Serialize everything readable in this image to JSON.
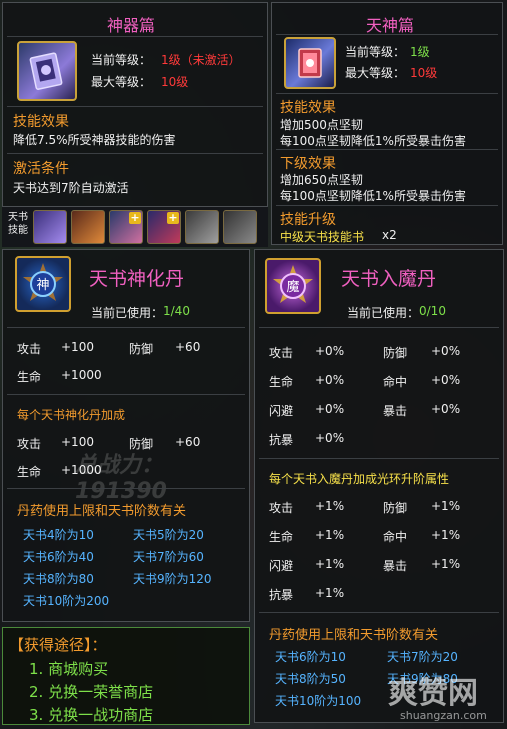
{
  "shenqi": {
    "title": "神器篇",
    "current_level_label": "当前等级：",
    "current_level_value": "1级（未激活）",
    "max_level_label": "最大等级：",
    "max_level_value": "10级",
    "effect_heading": "技能效果",
    "effect_text": "降低7.5%所受神器技能的伤害",
    "activate_heading": "激活条件",
    "activate_text": "天书达到7阶自动激活"
  },
  "tianshen": {
    "title": "天神篇",
    "current_level_label": "当前等级：",
    "current_level_value": "1级",
    "max_level_label": "最大等级：",
    "max_level_value": "10级",
    "effect_heading": "技能效果",
    "effect_lines": [
      "增加500点坚韧",
      "每100点坚韧降低1%所受暴击伤害"
    ],
    "next_heading": "下级效果",
    "next_lines": [
      "增加650点坚韧",
      "每100点坚韧降低1%所受暴击伤害"
    ],
    "upgrade_heading": "技能升级",
    "upgrade_item": "中级天书技能书",
    "upgrade_count": "x2"
  },
  "skill_bar": {
    "label_line1": "天书",
    "label_line2": "技能"
  },
  "shenhua": {
    "title": "天书神化丹",
    "icon_char": "神",
    "used_label": "当前已使用：",
    "used_value": "1/40",
    "base_stats": [
      {
        "name": "攻击",
        "value": "+100",
        "name2": "防御",
        "value2": "+60"
      },
      {
        "name": "生命",
        "value": "+1000"
      }
    ],
    "per_heading": "每个天书神化丹加成",
    "per_stats": [
      {
        "name": "攻击",
        "value": "+100",
        "name2": "防御",
        "value2": "+60"
      },
      {
        "name": "生命",
        "value": "+1000"
      }
    ],
    "limit_heading": "丹药使用上限和天书阶数有关",
    "limits": [
      "天书4阶为10",
      "天书5阶为20",
      "天书6阶为40",
      "天书7阶为60",
      "天书8阶为80",
      "天书9阶为120",
      "天书10阶为200"
    ],
    "power_text": "总战力：191390"
  },
  "rumo": {
    "title": "天书入魔丹",
    "icon_char": "魔",
    "used_label": "当前已使用：",
    "used_value": "0/10",
    "base_stats": [
      {
        "name": "攻击",
        "value": "+0%",
        "name2": "防御",
        "value2": "+0%"
      },
      {
        "name": "生命",
        "value": "+0%",
        "name2": "命中",
        "value2": "+0%"
      },
      {
        "name": "闪避",
        "value": "+0%",
        "name2": "暴击",
        "value2": "+0%"
      },
      {
        "name": "抗暴",
        "value": "+0%"
      }
    ],
    "per_heading": "每个天书入魔丹加成光环升阶属性",
    "per_stats": [
      {
        "name": "攻击",
        "value": "+1%",
        "name2": "防御",
        "value2": "+1%"
      },
      {
        "name": "生命",
        "value": "+1%",
        "name2": "命中",
        "value2": "+1%"
      },
      {
        "name": "闪避",
        "value": "+1%",
        "name2": "暴击",
        "value2": "+1%"
      },
      {
        "name": "抗暴",
        "value": "+1%"
      }
    ],
    "limit_heading": "丹药使用上限和天书阶数有关",
    "limits": [
      "天书6阶为10",
      "天书7阶为20",
      "天书8阶为50",
      "天书9阶为80",
      "天书10阶为100"
    ]
  },
  "obtain": {
    "heading": "【获得途径】：",
    "items": [
      "1. 商城购买",
      "2. 兑换一荣誉商店",
      "3. 兑换一战功商店"
    ]
  },
  "watermark": {
    "cn": "爽赞网",
    "url": "shuangzan.com"
  },
  "colors": {
    "title_pink": "#f060c0",
    "heading_orange": "#f29b2e",
    "value_red": "#ff3a3a",
    "green": "#7ee04a",
    "blue": "#56b4ff",
    "gold_border": "#c9a23a"
  }
}
